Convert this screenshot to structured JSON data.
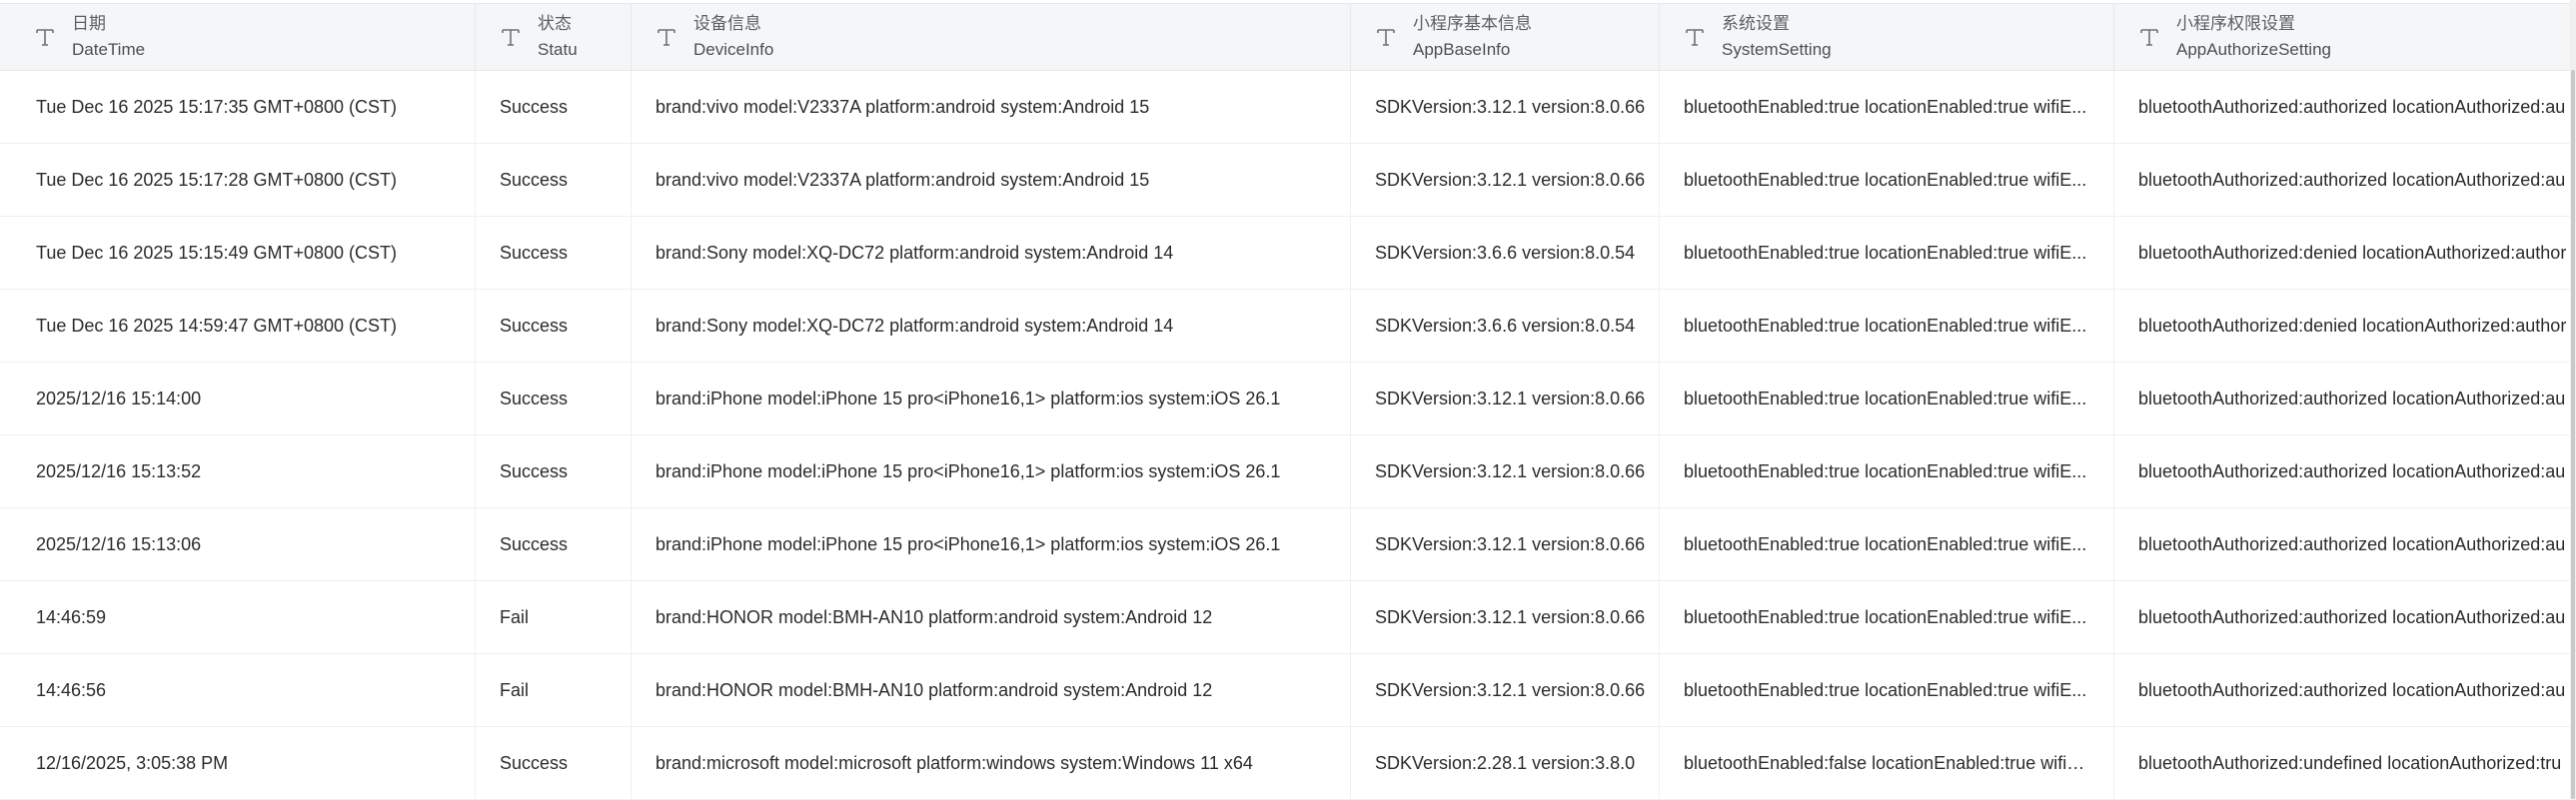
{
  "columns": [
    {
      "zh": "日期",
      "en": "DateTime",
      "icon": "text-type-icon"
    },
    {
      "zh": "状态",
      "en": "Statu",
      "icon": "text-type-icon"
    },
    {
      "zh": "设备信息",
      "en": "DeviceInfo",
      "icon": "text-type-icon"
    },
    {
      "zh": "小程序基本信息",
      "en": "AppBaseInfo",
      "icon": "text-type-icon"
    },
    {
      "zh": "系统设置",
      "en": "SystemSetting",
      "icon": "text-type-icon"
    },
    {
      "zh": "小程序权限设置",
      "en": "AppAuthorizeSetting",
      "icon": "text-type-icon"
    }
  ],
  "rows": [
    [
      "Tue Dec 16 2025 15:17:35 GMT+0800 (CST)",
      "Success",
      "brand:vivo model:V2337A platform:android system:Android 15",
      "SDKVersion:3.12.1 version:8.0.66",
      "bluetoothEnabled:true locationEnabled:true wifiE...",
      "bluetoothAuthorized:authorized locationAuthorized:au"
    ],
    [
      "Tue Dec 16 2025 15:17:28 GMT+0800 (CST)",
      "Success",
      "brand:vivo model:V2337A platform:android system:Android 15",
      "SDKVersion:3.12.1 version:8.0.66",
      "bluetoothEnabled:true locationEnabled:true wifiE...",
      "bluetoothAuthorized:authorized locationAuthorized:au"
    ],
    [
      "Tue Dec 16 2025 15:15:49 GMT+0800 (CST)",
      "Success",
      "brand:Sony model:XQ-DC72 platform:android system:Android 14",
      "SDKVersion:3.6.6 version:8.0.54",
      "bluetoothEnabled:true locationEnabled:true wifiE...",
      "bluetoothAuthorized:denied locationAuthorized:author"
    ],
    [
      "Tue Dec 16 2025 14:59:47 GMT+0800 (CST)",
      "Success",
      "brand:Sony model:XQ-DC72 platform:android system:Android 14",
      "SDKVersion:3.6.6 version:8.0.54",
      "bluetoothEnabled:true locationEnabled:true wifiE...",
      "bluetoothAuthorized:denied locationAuthorized:author"
    ],
    [
      "2025/12/16 15:14:00",
      "Success",
      "brand:iPhone model:iPhone 15 pro<iPhone16,1> platform:ios system:iOS 26.1",
      "SDKVersion:3.12.1 version:8.0.66",
      "bluetoothEnabled:true locationEnabled:true wifiE...",
      "bluetoothAuthorized:authorized locationAuthorized:au"
    ],
    [
      "2025/12/16 15:13:52",
      "Success",
      "brand:iPhone model:iPhone 15 pro<iPhone16,1> platform:ios system:iOS 26.1",
      "SDKVersion:3.12.1 version:8.0.66",
      "bluetoothEnabled:true locationEnabled:true wifiE...",
      "bluetoothAuthorized:authorized locationAuthorized:au"
    ],
    [
      "2025/12/16 15:13:06",
      "Success",
      "brand:iPhone model:iPhone 15 pro<iPhone16,1> platform:ios system:iOS 26.1",
      "SDKVersion:3.12.1 version:8.0.66",
      "bluetoothEnabled:true locationEnabled:true wifiE...",
      "bluetoothAuthorized:authorized locationAuthorized:au"
    ],
    [
      "14:46:59",
      "Fail",
      "brand:HONOR model:BMH-AN10 platform:android system:Android 12",
      "SDKVersion:3.12.1 version:8.0.66",
      "bluetoothEnabled:true locationEnabled:true wifiE...",
      "bluetoothAuthorized:authorized locationAuthorized:au"
    ],
    [
      "14:46:56",
      "Fail",
      "brand:HONOR model:BMH-AN10 platform:android system:Android 12",
      "SDKVersion:3.12.1 version:8.0.66",
      "bluetoothEnabled:true locationEnabled:true wifiE...",
      "bluetoothAuthorized:authorized locationAuthorized:au"
    ],
    [
      "12/16/2025, 3:05:38 PM",
      "Success",
      "brand:microsoft model:microsoft platform:windows system:Windows 11 x64",
      "SDKVersion:2.28.1 version:3.8.0",
      "bluetoothEnabled:false locationEnabled:true wifiE...",
      "bluetoothAuthorized:undefined locationAuthorized:tru"
    ]
  ]
}
